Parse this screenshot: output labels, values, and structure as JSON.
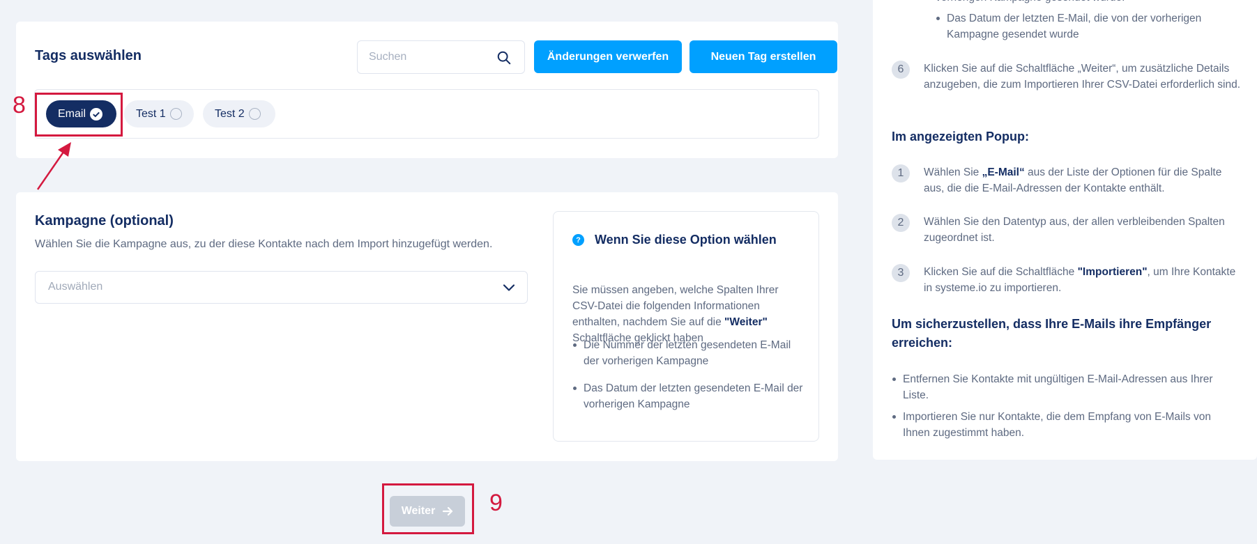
{
  "tags_section": {
    "title": "Tags auswählen",
    "search_placeholder": "Suchen",
    "discard_label": "Änderungen verwerfen",
    "create_label": "Neuen Tag erstellen",
    "tags": [
      {
        "label": "Email",
        "selected": true
      },
      {
        "label": "Test 1",
        "selected": false
      },
      {
        "label": "Test 2",
        "selected": false
      }
    ]
  },
  "campaign_section": {
    "title": "Kampagne (optional)",
    "description": "Wählen Sie die Kampagne aus, zu der diese Kontakte nach dem Import hinzugefügt werden.",
    "select_placeholder": "Auswählen",
    "info": {
      "icon": "?",
      "title": "Wenn Sie diese Option wählen",
      "text_pre": "Sie müssen angeben, welche Spalten Ihrer CSV-Datei die folgenden Informationen enthalten, nachdem Sie auf die",
      "text_bold": "\"Weiter\"",
      "text_post": "Schaltfläche geklickt haben",
      "bullets": [
        "Die Nummer der letzten gesendeten E-Mail der vorherigen Kampagne",
        "Das Datum der letzten gesendeten E-Mail der vorherigen Kampagne"
      ]
    }
  },
  "next_button": {
    "label": "Weiter",
    "icon": "arrow-right-icon"
  },
  "right_panel": {
    "top_cut_text": "vorherigen Kampagne gesendet wurde.",
    "top_bullet": "Das Datum der letzten E-Mail, die von der vorherigen Kampagne gesendet wurde",
    "step6_num": "6",
    "step6_text": "Klicken Sie auf die Schaltfläche „Weiter“, um zusätzliche Details anzugeben, die zum Importieren Ihrer CSV-Datei erforderlich sind.",
    "popup_heading": "Im angezeigten Popup:",
    "popup_steps": [
      {
        "num": "1",
        "pre": "Wählen Sie ",
        "bold": "„E-Mail“",
        "post": " aus der Liste der Optionen für die Spalte aus, die die E-Mail-Adressen der Kontakte enthält."
      },
      {
        "num": "2",
        "pre": "Wählen Sie den Datentyp aus, der allen verbleibenden Spalten zugeordnet ist.",
        "bold": "",
        "post": ""
      },
      {
        "num": "3",
        "pre": "Klicken Sie auf die Schaltfläche ",
        "bold": "\"Importieren\"",
        "post": ", um Ihre Kontakte in systeme.io zu importieren."
      }
    ],
    "delivery_heading": "Um sicherzustellen, dass Ihre E-Mails ihre Empfänger erreichen:",
    "delivery_bullets": [
      "Entfernen Sie Kontakte mit ungültigen E-Mail-Adressen aus Ihrer Liste.",
      "Importieren Sie nur Kontakte, die dem Empfang von E-Mails von Ihnen zugestimmt haben."
    ]
  },
  "annotations": {
    "label_8": "8",
    "label_9": "9",
    "color": "#d4193f"
  },
  "colors": {
    "primary": "#00a0ff",
    "navy": "#142d63",
    "background": "#f0f3f8"
  }
}
